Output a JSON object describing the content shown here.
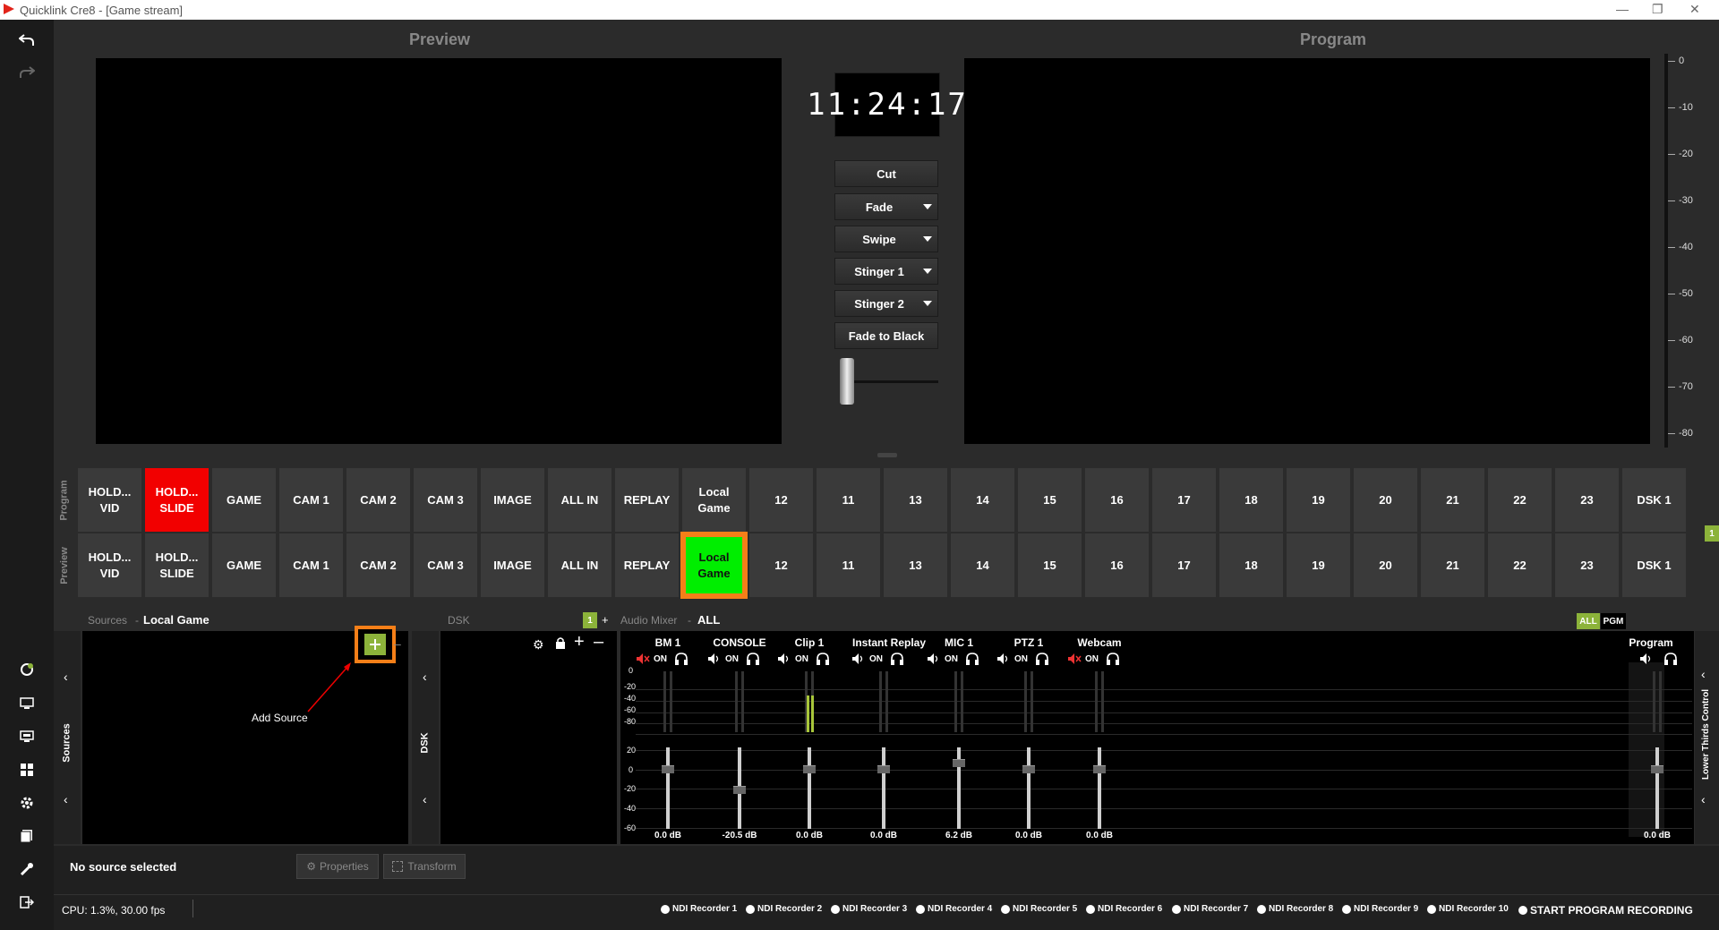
{
  "window": {
    "title": "Quicklink Cre8  - [Game stream]"
  },
  "panels": {
    "preview_title": "Preview",
    "program_title": "Program"
  },
  "clock": "11:24:17",
  "transitions": [
    {
      "label": "Cut",
      "dropdown": false
    },
    {
      "label": "Fade",
      "dropdown": true
    },
    {
      "label": "Swipe",
      "dropdown": true
    },
    {
      "label": "Stinger 1",
      "dropdown": true
    },
    {
      "label": "Stinger 2",
      "dropdown": true
    },
    {
      "label": "Fade to Black",
      "dropdown": false
    }
  ],
  "audio_meter_ticks": [
    "0",
    "-10",
    "-20",
    "-30",
    "-40",
    "-50",
    "-60",
    "-70",
    "-80"
  ],
  "switcher": {
    "program_label": "Program",
    "preview_label": "Preview",
    "program_row": [
      "HOLD... VID",
      "HOLD... SLIDE",
      "GAME",
      "CAM 1",
      "CAM 2",
      "CAM 3",
      "IMAGE",
      "ALL IN",
      "REPLAY",
      "Local Game",
      "12",
      "11",
      "13",
      "14",
      "15",
      "16",
      "17",
      "18",
      "19",
      "20",
      "21",
      "22",
      "23",
      "DSK 1"
    ],
    "preview_row": [
      "HOLD... VID",
      "HOLD... SLIDE",
      "GAME",
      "CAM 1",
      "CAM 2",
      "CAM 3",
      "IMAGE",
      "ALL IN",
      "REPLAY",
      "Local Game",
      "12",
      "11",
      "13",
      "14",
      "15",
      "16",
      "17",
      "18",
      "19",
      "20",
      "21",
      "22",
      "23",
      "DSK 1"
    ],
    "program_active": "HOLD... SLIDE",
    "preview_active": "Local Game",
    "page_badge": "1"
  },
  "sources": {
    "label": "Sources",
    "selected": "Local Game",
    "side_label": "Sources",
    "annotation": "Add Source"
  },
  "dsk": {
    "label": "DSK",
    "side_label": "DSK",
    "badge": "1"
  },
  "audio_mixer": {
    "label": "Audio Mixer",
    "filter": "ALL",
    "toggle_all": "ALL",
    "toggle_pgm": "PGM",
    "scale_top": [
      "0",
      "-20",
      "-40",
      "-60",
      "-80"
    ],
    "scale_bottom": [
      "20",
      "0",
      "-20",
      "-40",
      "-60"
    ],
    "channels": [
      {
        "name": "BM 1",
        "on": "ON",
        "muted": true,
        "db": "0.0 dB",
        "level": 0.0
      },
      {
        "name": "CONSOLE",
        "on": "ON",
        "muted": false,
        "db": "-20.5 dB",
        "level": -20.5
      },
      {
        "name": "Clip 1",
        "on": "ON",
        "muted": false,
        "db": "0.0 dB",
        "level": 0.0
      },
      {
        "name": "Instant Replay",
        "on": "ON",
        "muted": false,
        "db": "0.0 dB",
        "level": 0.0
      },
      {
        "name": "MIC 1",
        "on": "ON",
        "muted": false,
        "db": "6.2 dB",
        "level": 6.2
      },
      {
        "name": "PTZ 1",
        "on": "ON",
        "muted": false,
        "db": "0.0 dB",
        "level": 0.0
      },
      {
        "name": "Webcam",
        "on": "ON",
        "muted": true,
        "db": "0.0 dB",
        "level": 0.0
      }
    ],
    "program": {
      "name": "Program",
      "db": "0.0 dB",
      "level": 0.0
    }
  },
  "lower_thirds_label": "Lower Thirds Control",
  "bottom": {
    "no_source": "No source selected",
    "properties": "Properties",
    "transform": "Transform",
    "cpu": "CPU: 1.3%, 30.00 fps",
    "recorders": [
      "NDI Recorder 1",
      "NDI Recorder 2",
      "NDI Recorder 3",
      "NDI Recorder 4",
      "NDI Recorder 5",
      "NDI Recorder 6",
      "NDI Recorder 7",
      "NDI Recorder 8",
      "NDI Recorder 9",
      "NDI Recorder 10"
    ],
    "start_recording": "START PROGRAM RECORDING"
  },
  "colors": {
    "accent_green": "#00ee00",
    "highlight_orange": "#f57f18",
    "program_red": "#f20000",
    "badge_olive": "#8cb33a"
  }
}
